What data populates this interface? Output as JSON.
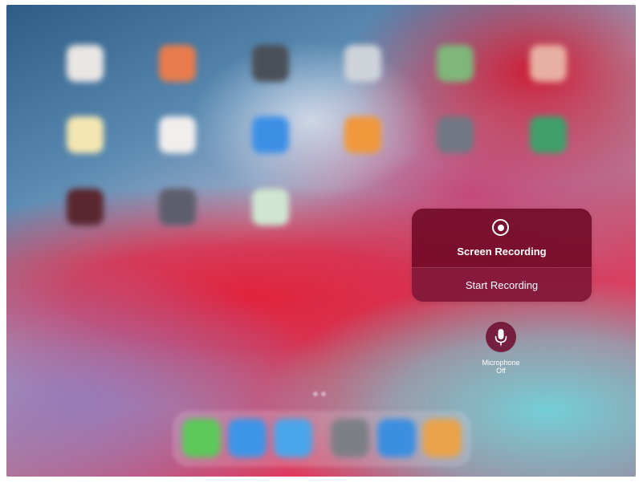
{
  "control_center": {
    "screen_recording": {
      "title": "Screen Recording",
      "action_label": "Start Recording",
      "icon": "record-icon"
    },
    "microphone": {
      "label": "Microphone",
      "status": "Off",
      "icon": "microphone-icon"
    }
  },
  "background": {
    "home_screen_icons": [
      {
        "name": "app-icon",
        "color": "#e9e6e4"
      },
      {
        "name": "photos-icon",
        "color": "#e87c4c"
      },
      {
        "name": "camera-icon",
        "color": "#4b4f57"
      },
      {
        "name": "clock-icon",
        "color": "#cfd3da"
      },
      {
        "name": "maps-icon",
        "color": "#7fb67a"
      },
      {
        "name": "google-icon",
        "color": "#e8b0a4"
      },
      {
        "name": "notes-icon",
        "color": "#f4e6b2"
      },
      {
        "name": "reminders-icon",
        "color": "#f2eeee"
      },
      {
        "name": "app-store-icon",
        "color": "#3d8fe6"
      },
      {
        "name": "books-icon",
        "color": "#f0983c"
      },
      {
        "name": "settings-icon",
        "color": "#717883"
      },
      {
        "name": "green-app-icon",
        "color": "#3fa06a"
      },
      {
        "name": "youtube-icon",
        "color": "#5a2730"
      },
      {
        "name": "folder-icon",
        "color": "#5d5e6d"
      },
      {
        "name": "drive-icon",
        "color": "#cfe6d2"
      }
    ],
    "dock_icons": [
      {
        "name": "messages-icon",
        "color": "#5cc95a"
      },
      {
        "name": "safari-icon",
        "color": "#3d95e8"
      },
      {
        "name": "mail-icon",
        "color": "#4aa6ea"
      },
      {
        "name": "settings-icon",
        "color": "#7c7f86"
      },
      {
        "name": "files-icon",
        "color": "#3c8ee0"
      },
      {
        "name": "photos-icon",
        "color": "#e9a24a"
      }
    ]
  }
}
